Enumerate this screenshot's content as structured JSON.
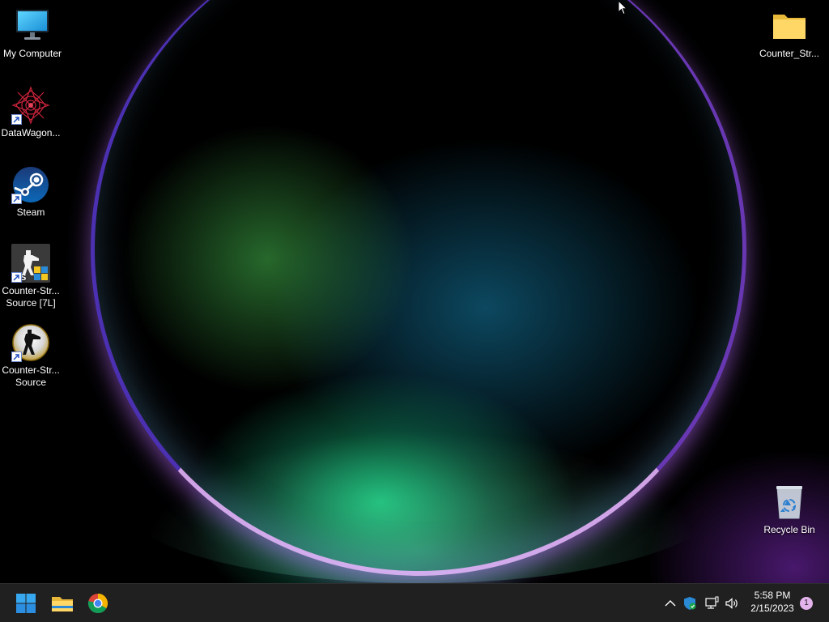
{
  "desktop": {
    "icons": [
      {
        "label": "My Computer",
        "icon": "monitor-icon"
      },
      {
        "label": "DataWagon...",
        "icon": "datawagon-icon"
      },
      {
        "label": "Steam",
        "icon": "steam-icon"
      },
      {
        "label": "Counter-Str... Source [7L]",
        "label_line1": "Counter-Str...",
        "label_line2": "Source [7L]",
        "icon": "css-7l-icon"
      },
      {
        "label": "Counter-Str... Source",
        "label_line1": "Counter-Str...",
        "label_line2": "Source",
        "icon": "css-icon"
      },
      {
        "label": "Counter_Str...",
        "icon": "folder-icon"
      },
      {
        "label": "Recycle Bin",
        "icon": "recycle-bin-icon"
      }
    ]
  },
  "taskbar": {
    "pinned": [
      {
        "name": "start",
        "icon": "windows-logo-icon"
      },
      {
        "name": "file-explorer",
        "icon": "folder-icon"
      },
      {
        "name": "chrome",
        "icon": "chrome-icon"
      }
    ],
    "tray": {
      "icons": [
        "chevron-up-icon",
        "windows-security-icon",
        "network-icon",
        "volume-icon"
      ],
      "time": "5:58 PM",
      "date": "2/15/2023",
      "notification_count": "1"
    }
  },
  "colors": {
    "taskbar_bg": "#202020",
    "accent_blue": "#0078d4",
    "notification_badge": "#e3b3ec"
  }
}
